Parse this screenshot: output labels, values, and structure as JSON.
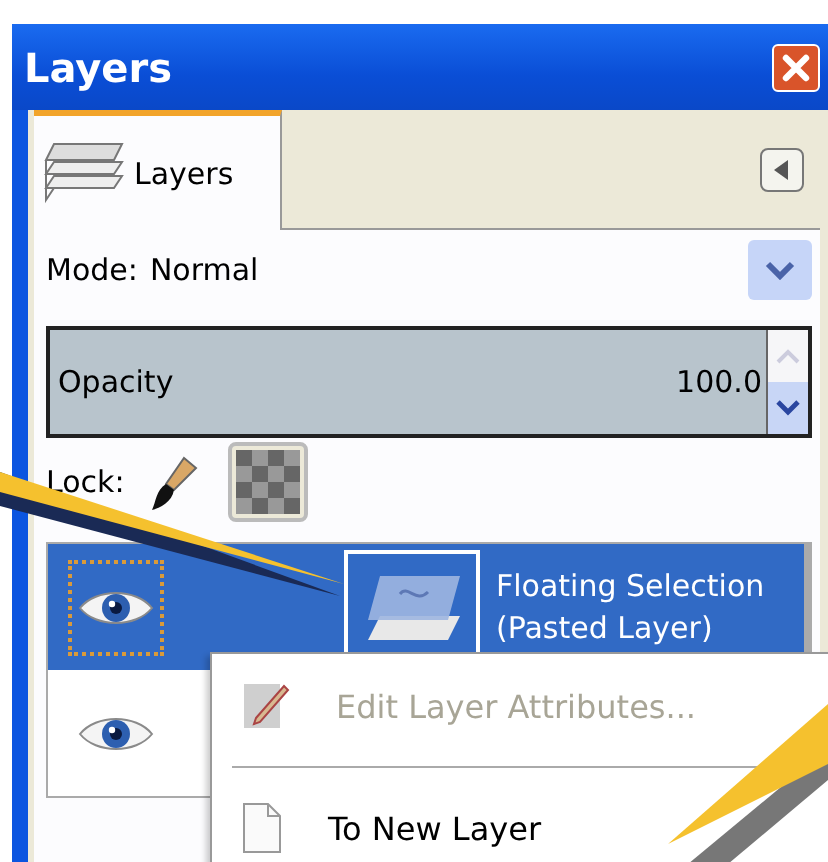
{
  "window": {
    "title": "Layers"
  },
  "tabs": [
    {
      "label": "Layers",
      "selected": true
    }
  ],
  "mode": {
    "label": "Mode:",
    "value": "Normal"
  },
  "opacity": {
    "label": "Opacity",
    "value": "100.0",
    "level": 1
  },
  "lock": {
    "label": "Lock:",
    "pixels": false,
    "alpha": true
  },
  "layers": [
    {
      "name": "Floating Selection\n(Pasted Layer)",
      "selected": true,
      "visible": true,
      "focused": true
    },
    {
      "selected": false,
      "visible": true,
      "focused": false
    }
  ],
  "context_menu": [
    {
      "kind": "item",
      "label": "Edit Layer Attributes...",
      "disabled": true
    },
    {
      "kind": "separator"
    },
    {
      "kind": "item",
      "label": "To New Layer",
      "disabled": false
    }
  ]
}
